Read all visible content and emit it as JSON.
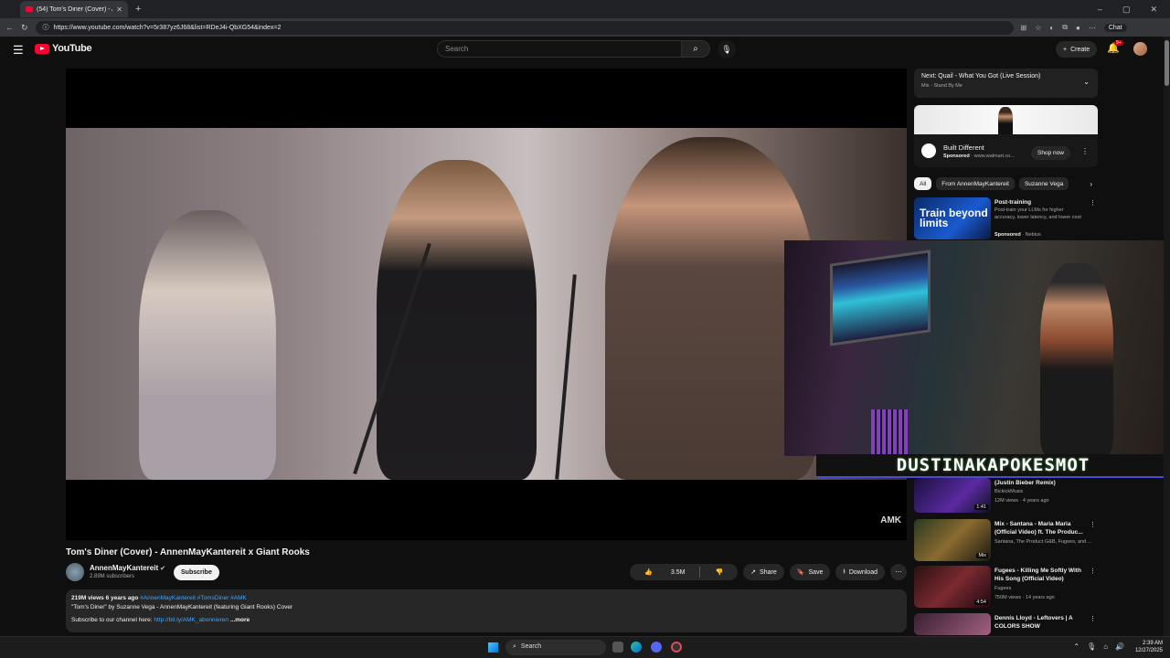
{
  "browser": {
    "tab_title": "(54) Tom's Diner (Cover) - An",
    "new_tab": "+",
    "url": "https://www.youtube.com/watch?v=5r387yz6J68&list=RDeJ4i-QbXG54&index=2",
    "chat_label": "Chat"
  },
  "header": {
    "logo_text": "YouTube",
    "search_placeholder": "Search",
    "create_label": "Create",
    "notif_count": "9+"
  },
  "video": {
    "watermark": "AMK",
    "title": "Tom's Diner (Cover) - AnnenMayKantereit x Giant Rooks",
    "channel_name": "AnnenMayKantereit",
    "subscribers": "2.89M subscribers",
    "subscribe_label": "Subscribe",
    "likes": "3.5M",
    "share_label": "Share",
    "save_label": "Save",
    "download_label": "Download"
  },
  "overlay": {
    "streamer_name": "DUSTINAKAPOKESMOT"
  },
  "description": {
    "meta": "219M views  6 years ago",
    "tags": "#AnnenMayKantereit #TomsDiner #AMK",
    "line1": "\"Tom's Diner\" by Suzanne Vega - AnnenMayKantereit (featuring Giant Rooks) Cover",
    "line2_prefix": "Subscribe to our channel here: ",
    "link": "http://bit.ly/AMK_abonnieren",
    "more": "...more"
  },
  "sidebar": {
    "up_next_title": "Next: Quail - What You Got (Live Session)",
    "up_next_sub": "Mix - Stand By Me",
    "ad": {
      "title": "Built Different",
      "sponsored": "Sponsored",
      "domain": "· www.walmart.co...",
      "shop_label": "Shop now"
    },
    "chips": [
      "All",
      "From AnnenMayKantereit",
      "Suzanne Vega"
    ],
    "promo": {
      "thumb_text": "Train beyond limits",
      "title": "Post-training",
      "desc": "Post-train your LLMs for higher accuracy, lower latency, and lower cost",
      "sponsored": "Sponsored",
      "advertiser": "· Nebius"
    },
    "recs": [
      {
        "title": "(Justin Bieber Remix)",
        "channel": "BickickMusic",
        "meta": "12M views · 4 years ago",
        "duration": "1:41"
      },
      {
        "title": "Mix - Santana - Maria Maria (Official Video) ft. The Produc...",
        "channel": "Santana, The Product G&B, Fugees, and ...",
        "meta": "",
        "duration": "Mix"
      },
      {
        "title": "Fugees - Killing Me Softly With His Song (Official Video)",
        "channel": "Fugees",
        "meta": "750M views · 14 years ago",
        "duration": "4:54"
      },
      {
        "title": "Dennis Lloyd - Leftovers | A COLORS SHOW",
        "channel": "",
        "meta": "",
        "duration": ""
      }
    ]
  },
  "taskbar": {
    "search_label": "Search",
    "time": "2:39 AM",
    "date": "12/27/2025"
  }
}
